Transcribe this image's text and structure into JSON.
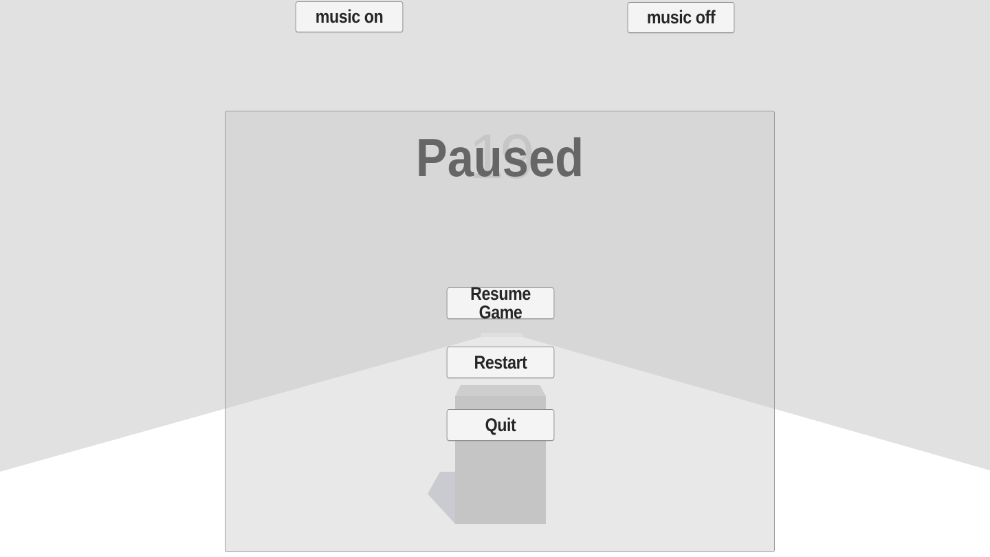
{
  "hud": {
    "music_on_label": "music on",
    "music_off_label": "music off",
    "score": "19"
  },
  "pause_menu": {
    "title": "Paused",
    "resume_label": "Resume Game",
    "restart_label": "Restart",
    "quit_label": "Quit"
  },
  "colors": {
    "wall": "#e1e1e1",
    "floor": "#ffffff",
    "block_front": "#c0c0c0",
    "block_top": "#cfcfcf",
    "block_shadow": "#c6cbd6",
    "title_text": "#666666"
  }
}
